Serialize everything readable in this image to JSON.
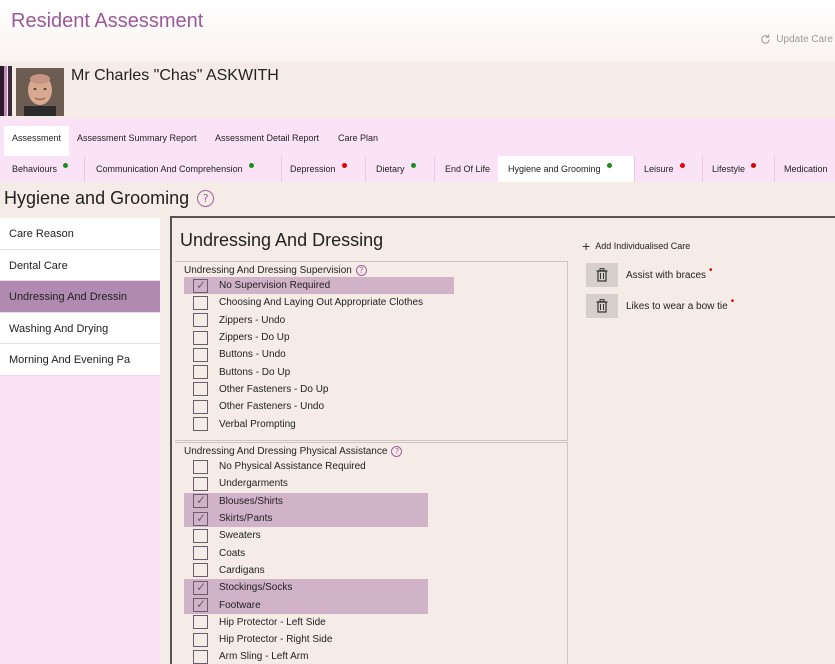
{
  "app": {
    "title": "Resident Assessment",
    "update_care": "Update Care"
  },
  "resident": {
    "name": "Mr Charles \"Chas\" ASKWITH"
  },
  "tabs": [
    {
      "label": "Assessment",
      "active": true
    },
    {
      "label": "Assessment Summary Report",
      "active": false
    },
    {
      "label": "Assessment Detail Report",
      "active": false
    },
    {
      "label": "Care Plan",
      "active": false
    }
  ],
  "categories": [
    {
      "label": "Behaviours",
      "status": "green"
    },
    {
      "label": "Communication And Comprehension",
      "status": "green"
    },
    {
      "label": "Depression",
      "status": "red"
    },
    {
      "label": "Dietary",
      "status": "green"
    },
    {
      "label": "End Of Life",
      "status": "none"
    },
    {
      "label": "Hygiene and Grooming",
      "status": "green",
      "active": true
    },
    {
      "label": "Leisure",
      "status": "red"
    },
    {
      "label": "Lifestyle",
      "status": "red"
    },
    {
      "label": "Medication",
      "status": "none"
    }
  ],
  "section": {
    "title": "Hygiene and Grooming",
    "help": "?"
  },
  "sidebar": {
    "items": [
      {
        "label": "Care Reason"
      },
      {
        "label": "Dental Care"
      },
      {
        "label": "Undressing And Dressin",
        "active": true
      },
      {
        "label": "Washing And Drying"
      },
      {
        "label": "Morning And Evening Pa"
      }
    ]
  },
  "content": {
    "title": "Undressing And Dressing",
    "supervision": {
      "heading": "Undressing And Dressing Supervision",
      "help": "?",
      "options": [
        {
          "label": "No Supervision Required",
          "checked": true
        },
        {
          "label": "Choosing And Laying Out Appropriate Clothes",
          "checked": false
        },
        {
          "label": "Zippers - Undo",
          "checked": false
        },
        {
          "label": "Zippers - Do Up",
          "checked": false
        },
        {
          "label": "Buttons - Undo",
          "checked": false
        },
        {
          "label": "Buttons - Do Up",
          "checked": false
        },
        {
          "label": "Other Fasteners - Do Up",
          "checked": false
        },
        {
          "label": "Other Fasteners - Undo",
          "checked": false
        },
        {
          "label": "Verbal Prompting",
          "checked": false
        }
      ]
    },
    "physical": {
      "heading": "Undressing And Dressing Physical Assistance",
      "help": "?",
      "options": [
        {
          "label": "No Physical Assistance Required",
          "checked": false
        },
        {
          "label": "Undergarments",
          "checked": false
        },
        {
          "label": "Blouses/Shirts",
          "checked": true
        },
        {
          "label": "Skirts/Pants",
          "checked": true
        },
        {
          "label": "Sweaters",
          "checked": false
        },
        {
          "label": "Coats",
          "checked": false
        },
        {
          "label": "Cardigans",
          "checked": false
        },
        {
          "label": "Stockings/Socks",
          "checked": true
        },
        {
          "label": "Footware",
          "checked": true
        },
        {
          "label": "Hip Protector - Left Side",
          "checked": false
        },
        {
          "label": "Hip Protector - Right Side",
          "checked": false
        },
        {
          "label": "Arm Sling - Left Arm",
          "checked": false
        }
      ]
    },
    "add_care_label": "Add Individualised Care",
    "individual_care": [
      {
        "label": "Assist with braces"
      },
      {
        "label": "Likes to wear a bow tie"
      }
    ],
    "required_marker": "•"
  },
  "colors": {
    "accent": "#9a5a98",
    "tab_bg": "#fbe3f7",
    "selected": "#b08ab0",
    "checked_row": "#d0b3c8",
    "status_green": "#1c8c1c",
    "status_red": "#e00000"
  }
}
